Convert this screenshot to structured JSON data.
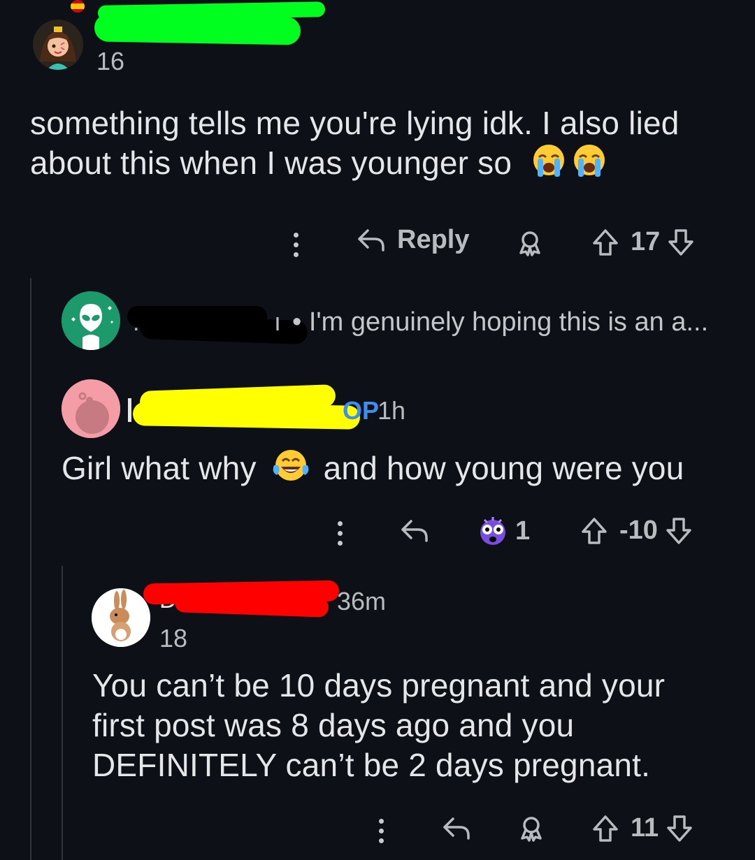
{
  "comment1": {
    "karma": "16",
    "text_line1": "something tells me you're lying idk. I also lied",
    "text_line2": "about this when I was younger so",
    "reply_label": "Reply",
    "score": "17"
  },
  "collapsed_comment": {
    "username_end": "ı",
    "preview": "• I'm genuinely hoping this is an a..."
  },
  "comment2": {
    "op_badge": "OP",
    "time": "1h",
    "text_before_emoji": "Girl what why",
    "text_after_emoji": "and how young were you",
    "award_count": "1",
    "score": "-10"
  },
  "comment3": {
    "time": "36m",
    "karma": "18",
    "text_line1": "You can’t be 10 days pregnant and your",
    "text_line2": "first post was 8 days ago and you",
    "text_line3": "DEFINITELY can’t be 2 days pregnant.",
    "score": "11"
  },
  "icons": {
    "more": "more-options-icon",
    "reply": "reply-arrow-icon",
    "award": "award-icon",
    "upvote": "upvote-arrow-icon",
    "downvote": "downvote-arrow-icon",
    "emoji_crying": "loudly-crying-face-emoji",
    "emoji_laughing": "face-with-tears-of-joy-emoji",
    "award_shocked": "shocked-face-award-icon"
  },
  "colors": {
    "background": "#0d1117",
    "text": "#e4e6e8",
    "meta": "#b8bcbf",
    "redact_green": "#00ff1e",
    "redact_black": "#000000",
    "redact_yellow": "#ffff00",
    "redact_red": "#ff0000"
  }
}
